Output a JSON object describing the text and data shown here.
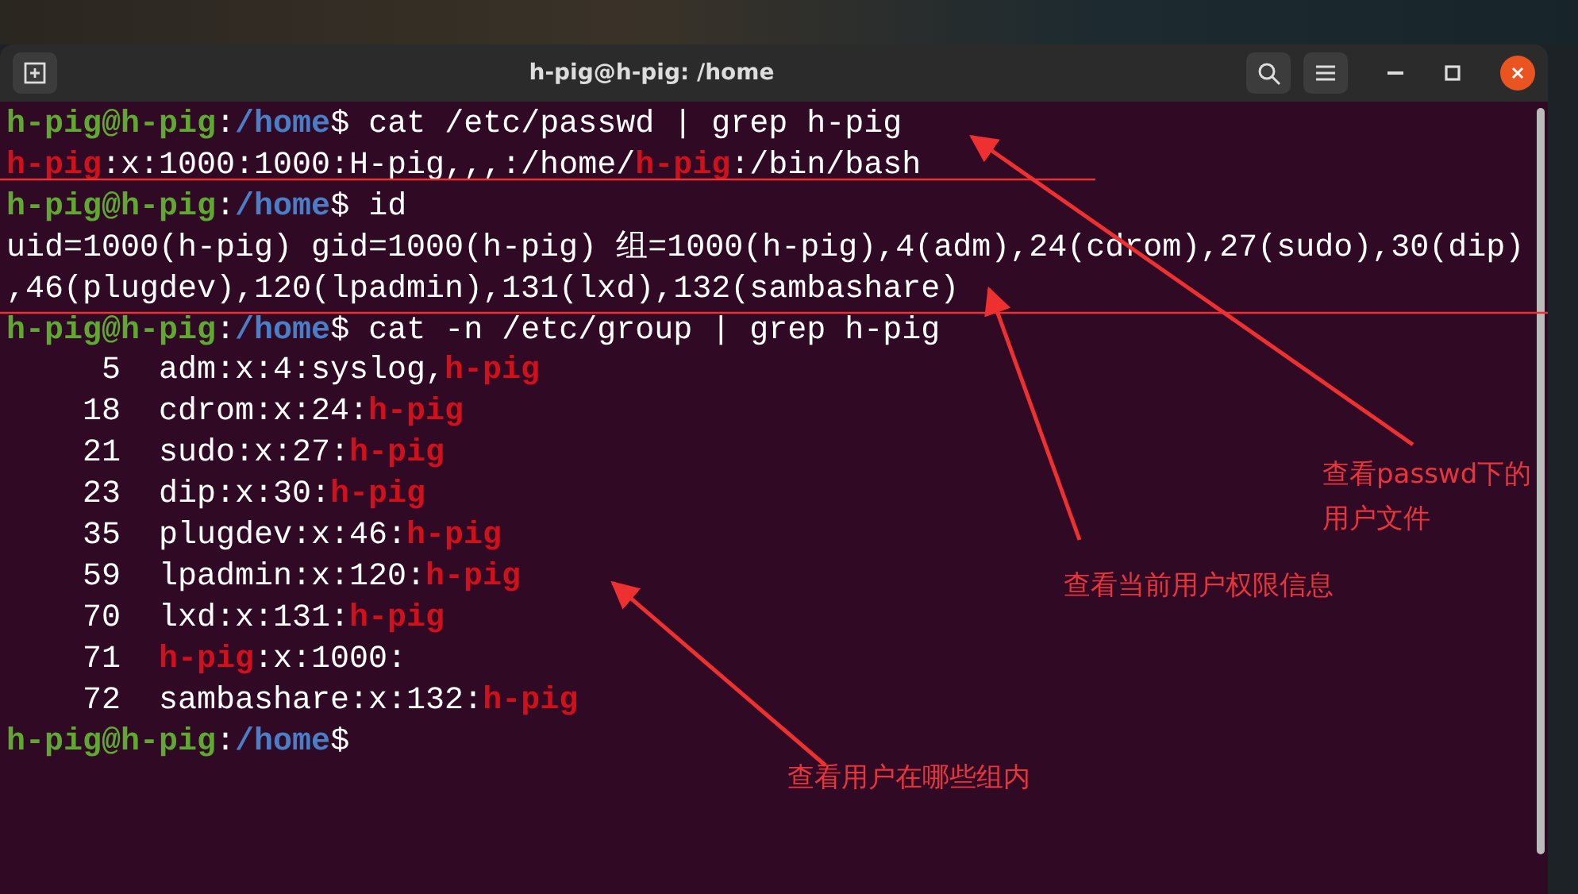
{
  "window": {
    "title": "h-pig@h-pig: /home"
  },
  "terminal": {
    "lines": [
      {
        "segments": [
          {
            "text": "h-pig@h-pig",
            "kind": "user"
          },
          {
            "text": ":",
            "kind": "plain"
          },
          {
            "text": "/home",
            "kind": "path"
          },
          {
            "text": "$ cat /etc/passwd | grep h-pig",
            "kind": "plain"
          }
        ]
      },
      {
        "segments": [
          {
            "text": "h-pig",
            "kind": "match"
          },
          {
            "text": ":x:1000:1000:H-pig,,,:/home/",
            "kind": "plain"
          },
          {
            "text": "h-pig",
            "kind": "match"
          },
          {
            "text": ":/bin/bash",
            "kind": "plain"
          }
        ]
      },
      {
        "segments": [
          {
            "text": "h-pig@h-pig",
            "kind": "user"
          },
          {
            "text": ":",
            "kind": "plain"
          },
          {
            "text": "/home",
            "kind": "path"
          },
          {
            "text": "$ id",
            "kind": "plain"
          }
        ]
      },
      {
        "segments": [
          {
            "text": "uid=1000(h-pig) gid=1000(h-pig) 组=1000(h-pig),4(adm),24(cdrom),27(sudo),30(dip)",
            "kind": "plain"
          }
        ]
      },
      {
        "segments": [
          {
            "text": ",46(plugdev),120(lpadmin),131(lxd),132(sambashare)",
            "kind": "plain"
          }
        ]
      },
      {
        "segments": [
          {
            "text": "h-pig@h-pig",
            "kind": "user"
          },
          {
            "text": ":",
            "kind": "plain"
          },
          {
            "text": "/home",
            "kind": "path"
          },
          {
            "text": "$ cat -n /etc/group | grep h-pig",
            "kind": "plain"
          }
        ]
      },
      {
        "segments": [
          {
            "text": "     5  adm:x:4:syslog,",
            "kind": "plain"
          },
          {
            "text": "h-pig",
            "kind": "match"
          }
        ]
      },
      {
        "segments": [
          {
            "text": "    18  cdrom:x:24:",
            "kind": "plain"
          },
          {
            "text": "h-pig",
            "kind": "match"
          }
        ]
      },
      {
        "segments": [
          {
            "text": "    21  sudo:x:27:",
            "kind": "plain"
          },
          {
            "text": "h-pig",
            "kind": "match"
          }
        ]
      },
      {
        "segments": [
          {
            "text": "    23  dip:x:30:",
            "kind": "plain"
          },
          {
            "text": "h-pig",
            "kind": "match"
          }
        ]
      },
      {
        "segments": [
          {
            "text": "    35  plugdev:x:46:",
            "kind": "plain"
          },
          {
            "text": "h-pig",
            "kind": "match"
          }
        ]
      },
      {
        "segments": [
          {
            "text": "    59  lpadmin:x:120:",
            "kind": "plain"
          },
          {
            "text": "h-pig",
            "kind": "match"
          }
        ]
      },
      {
        "segments": [
          {
            "text": "    70  lxd:x:131:",
            "kind": "plain"
          },
          {
            "text": "h-pig",
            "kind": "match"
          }
        ]
      },
      {
        "segments": [
          {
            "text": "    71  ",
            "kind": "plain"
          },
          {
            "text": "h-pig",
            "kind": "match"
          },
          {
            "text": ":x:1000:",
            "kind": "plain"
          }
        ]
      },
      {
        "segments": [
          {
            "text": "    72  sambashare:x:132:",
            "kind": "plain"
          },
          {
            "text": "h-pig",
            "kind": "match"
          }
        ]
      },
      {
        "segments": [
          {
            "text": "h-pig@h-pig",
            "kind": "user"
          },
          {
            "text": ":",
            "kind": "plain"
          },
          {
            "text": "/home",
            "kind": "path"
          },
          {
            "text": "$",
            "kind": "plain"
          }
        ]
      }
    ]
  },
  "annotations": [
    {
      "lines": [
        "查看passwd下的",
        "用户文件"
      ]
    },
    {
      "lines": [
        "查看当前用户权限信息"
      ]
    },
    {
      "lines": [
        "查看用户在哪些组内"
      ]
    }
  ]
}
